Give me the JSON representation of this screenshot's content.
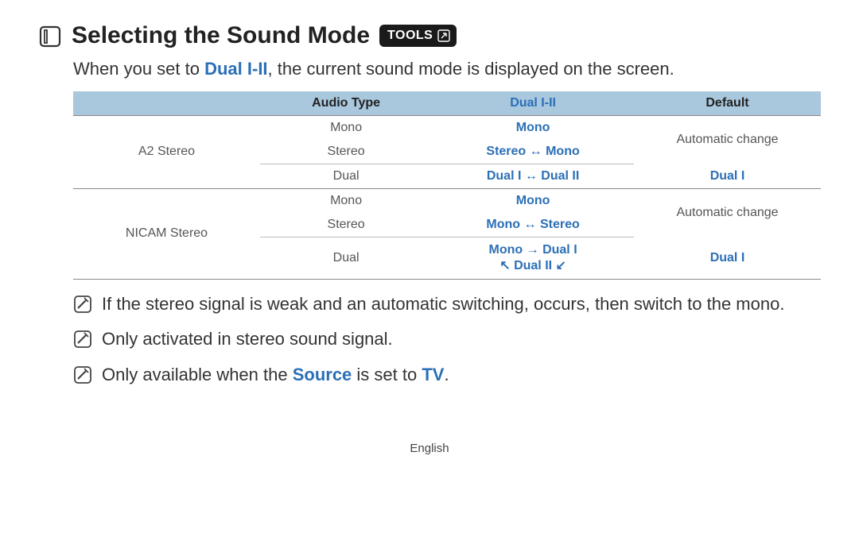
{
  "heading": {
    "title": "Selecting the Sound Mode",
    "tools_label": "TOOLS"
  },
  "intro": {
    "pre": "When you set to ",
    "emph": "Dual I-II",
    "post": ", the current sound mode is displayed on the screen."
  },
  "table": {
    "headers": {
      "col0": "",
      "audio_type": "Audio Type",
      "dual": "Dual I-II",
      "default": "Default"
    },
    "group1": {
      "label": "A2 Stereo",
      "rows": [
        {
          "audio": "Mono",
          "dual": "Mono",
          "def": ""
        },
        {
          "audio": "Stereo",
          "dual": "Stereo ↔ Mono",
          "def": "Automatic change"
        },
        {
          "audio": "Dual",
          "dual": "Dual I ↔ Dual II",
          "def": "Dual I"
        }
      ]
    },
    "group2": {
      "label": "NICAM Stereo",
      "rows": [
        {
          "audio": "Mono",
          "dual": "Mono",
          "def": ""
        },
        {
          "audio": "Stereo",
          "dual": "Mono ↔ Stereo",
          "def": "Automatic change"
        },
        {
          "audio": "Dual",
          "dual_line1": "Mono → Dual I",
          "dual_line2": "↖ Dual II ↙",
          "def": "Dual I"
        }
      ]
    }
  },
  "notes": {
    "n1": "If the stereo signal is weak and an automatic switching, occurs, then switch to the mono.",
    "n2": "Only activated in stereo sound signal.",
    "n3_pre": "Only available when the ",
    "n3_src": "Source",
    "n3_mid": " is set to ",
    "n3_tv": "TV",
    "n3_post": "."
  },
  "footer": "English"
}
